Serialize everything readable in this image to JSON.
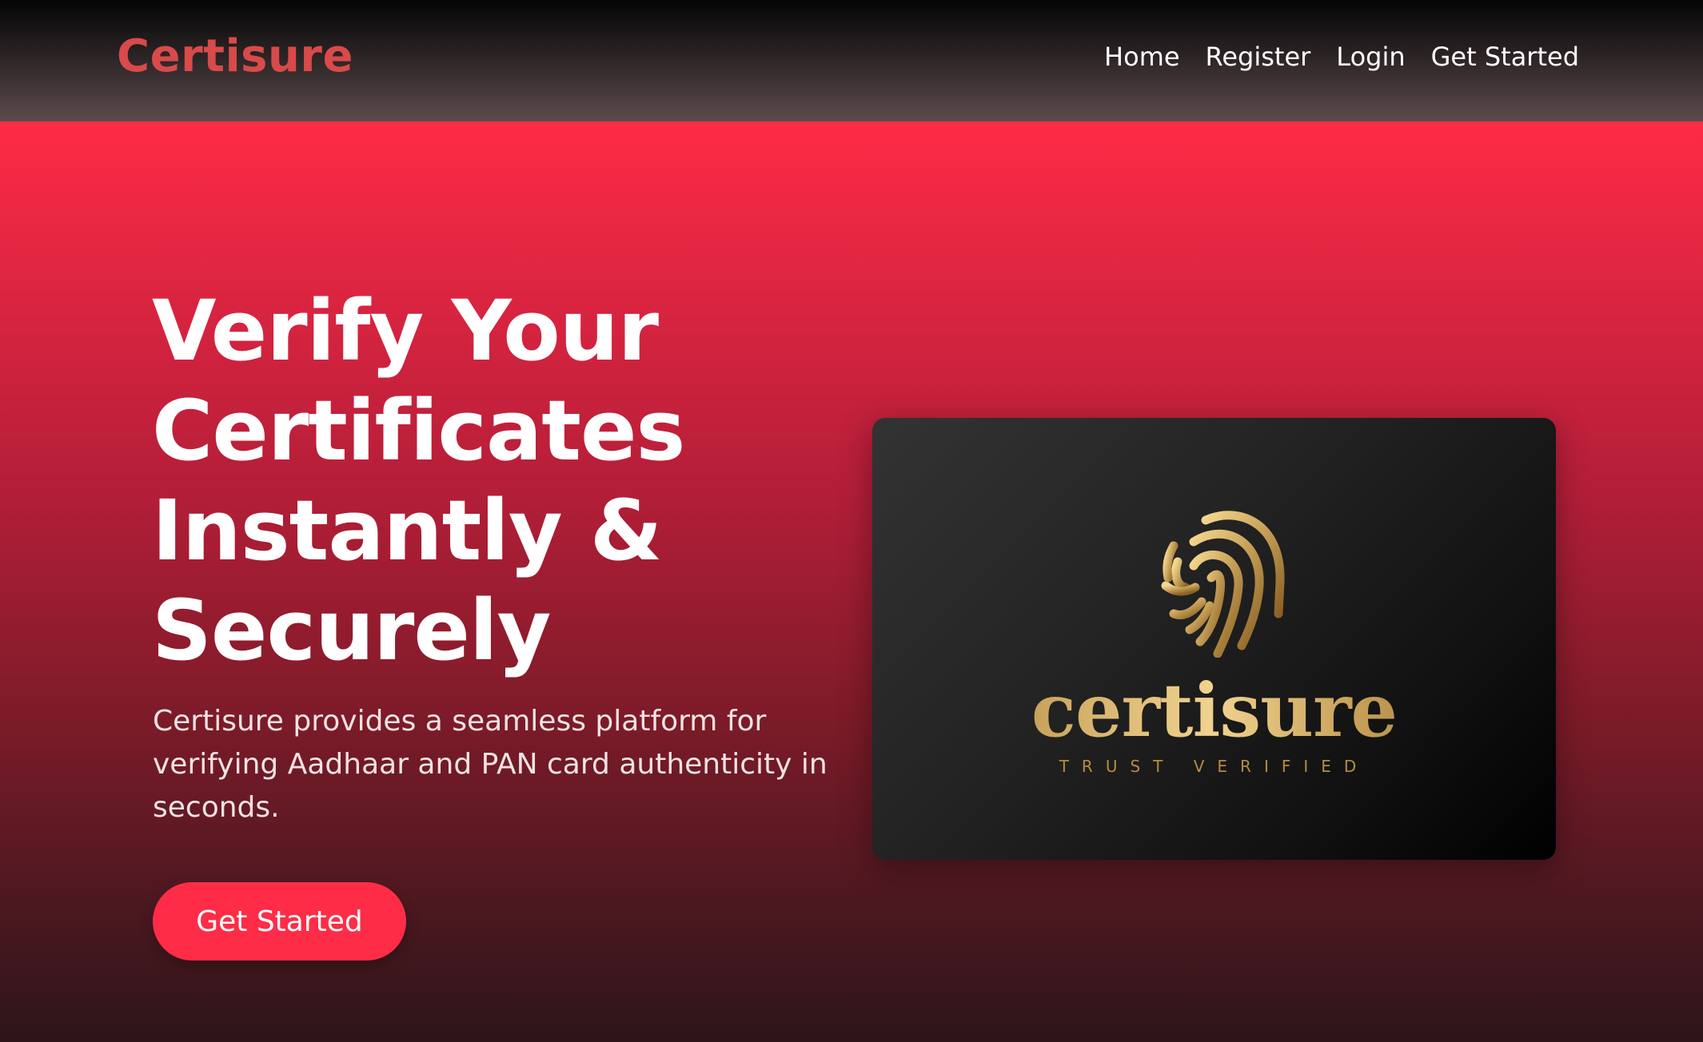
{
  "nav": {
    "brand": "Certisure",
    "links": [
      "Home",
      "Register",
      "Login",
      "Get Started"
    ]
  },
  "hero": {
    "headline": "Verify Your Certificates Instantly & Securely",
    "description": "Certisure provides a seamless platform for verifying Aadhaar and PAN card authenticity in seconds.",
    "cta_label": "Get Started"
  },
  "card": {
    "icon": "fingerprint-icon",
    "wordmark": "certisure",
    "tagline": "TRUST VERIFIED"
  },
  "colors": {
    "brand": "#d94a4a",
    "accent": "#fe2c47",
    "gold": "#c8a25a",
    "card_bg": "#1c1c1c"
  }
}
